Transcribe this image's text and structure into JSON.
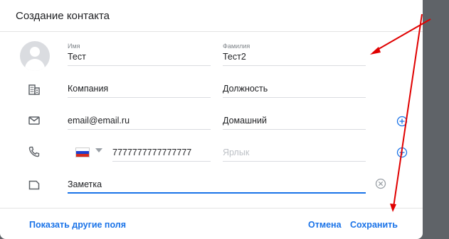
{
  "dialog": {
    "title": "Создание контакта"
  },
  "name": {
    "first_label": "Имя",
    "first_value": "Тест",
    "last_label": "Фамилия",
    "last_value": "Тест2"
  },
  "company": {
    "company_value": "Компания",
    "position_value": "Должность"
  },
  "email": {
    "value": "email@email.ru",
    "type_value": "Домашний"
  },
  "phone": {
    "value": "7777777777777777",
    "label_placeholder": "Ярлык"
  },
  "note": {
    "value": "Заметка"
  },
  "footer": {
    "more_fields": "Показать другие поля",
    "cancel": "Отмена",
    "save": "Сохранить"
  },
  "colors": {
    "accent": "#1a73e8",
    "annotation": "#e00000"
  },
  "icons": {
    "avatar": "avatar-icon",
    "company": "building-icon",
    "email": "mail-icon",
    "phone": "phone-icon",
    "note": "note-icon",
    "add": "add-circle-icon",
    "clear": "clear-circle-icon",
    "flag": "russia-flag-icon"
  }
}
